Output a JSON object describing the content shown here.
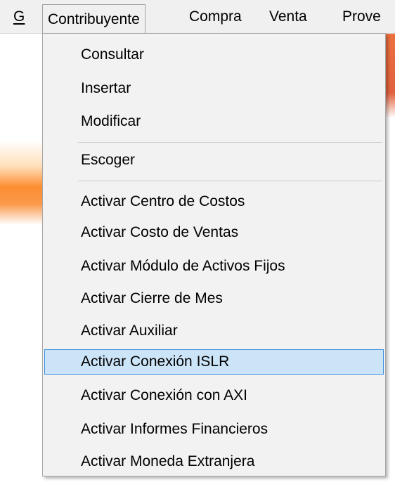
{
  "menubar": {
    "items": [
      {
        "label": "G"
      },
      {
        "label": "Contribuyente"
      },
      {
        "label": "Compra"
      },
      {
        "label": "Venta"
      },
      {
        "label": "Prove"
      }
    ]
  },
  "dropdown": {
    "items": [
      {
        "label": "Consultar"
      },
      {
        "label": "Insertar"
      },
      {
        "label": "Modificar"
      },
      {
        "label": "Escoger"
      },
      {
        "label": "Activar Centro de Costos"
      },
      {
        "label": "Activar Costo de Ventas"
      },
      {
        "label": "Activar Módulo de Activos Fijos"
      },
      {
        "label": "Activar Cierre de Mes"
      },
      {
        "label": "Activar Auxiliar"
      },
      {
        "label": "Activar Conexión ISLR",
        "selected": true
      },
      {
        "label": "Activar Conexión con AXI"
      },
      {
        "label": "Activar Informes Financieros"
      },
      {
        "label": "Activar Moneda Extranjera"
      }
    ]
  },
  "colors": {
    "menu_background": "#f2f2f2",
    "highlight_background": "#cce4f7",
    "highlight_border": "#3d8ee0"
  }
}
